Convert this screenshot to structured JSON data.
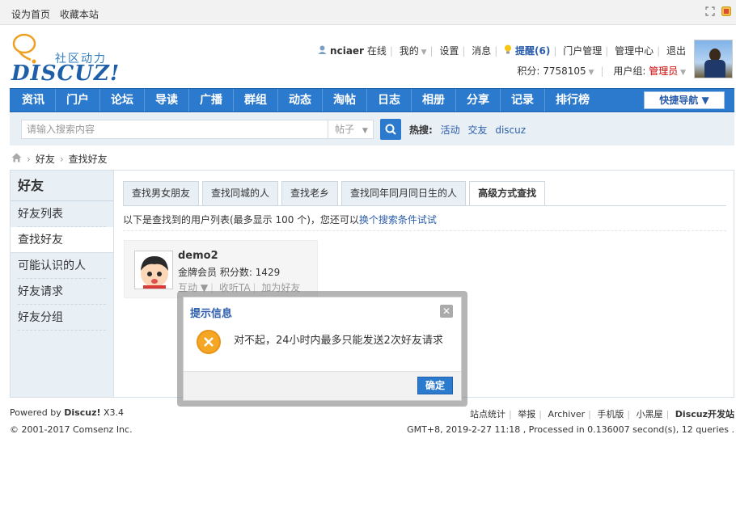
{
  "topbar": {
    "set_home": "设为首页",
    "bookmark": "收藏本站"
  },
  "logo": {
    "cn": "社区动力",
    "en": "DISCUZ!"
  },
  "user": {
    "name": "nciaer",
    "status": "在线",
    "my": "我的",
    "settings": "设置",
    "messages": "消息",
    "remind": "提醒(6)",
    "portal_admin": "门户管理",
    "admin_center": "管理中心",
    "logout": "退出",
    "points": "积分: 7758105",
    "group_label": "用户组: ",
    "group_value": "管理员"
  },
  "nav": {
    "items": [
      "资讯",
      "门户",
      "论坛",
      "导读",
      "广播",
      "群组",
      "动态",
      "淘帖",
      "日志",
      "相册",
      "分享",
      "记录",
      "排行榜"
    ],
    "quick": "快捷导航 ▼"
  },
  "search": {
    "placeholder": "请输入搜索内容",
    "type": "帖子",
    "hot_label": "热搜:",
    "hot_keywords": [
      "活动",
      "交友",
      "discuz"
    ]
  },
  "breadcrumb": {
    "level1": "好友",
    "level2": "查找好友"
  },
  "sidebar": {
    "title": "好友",
    "items": [
      "好友列表",
      "查找好友",
      "可能认识的人",
      "好友请求",
      "好友分组"
    ]
  },
  "tabs": [
    "查找男女朋友",
    "查找同城的人",
    "查找老乡",
    "查找同年同月同日生的人",
    "高级方式查找"
  ],
  "notice": {
    "text": "以下是查找到的用户列表(最多显示 100 个)，您还可以",
    "link": "换个搜索条件试试"
  },
  "result_user": {
    "name": "demo2",
    "info": "金牌会员  积分数: 1429",
    "action_interact": "互动 ▼",
    "action_follow": "收听TA",
    "action_add": "加为好友"
  },
  "modal": {
    "title": "提示信息",
    "message": "对不起，24小时内最多只能发送2次好友请求",
    "ok": "确定"
  },
  "footer": {
    "powered_prefix": "Powered by ",
    "powered_name": "Discuz!",
    "powered_version": " X3.4",
    "copyright": "© 2001-2017 Comsenz Inc.",
    "links": [
      "站点统计",
      "举报",
      "Archiver",
      "手机版",
      "小黑屋"
    ],
    "studio": "Discuz开发站",
    "runtime": "GMT+8, 2019-2-27 11:18 , Processed in 0.136007 second(s), 12 queries ."
  }
}
